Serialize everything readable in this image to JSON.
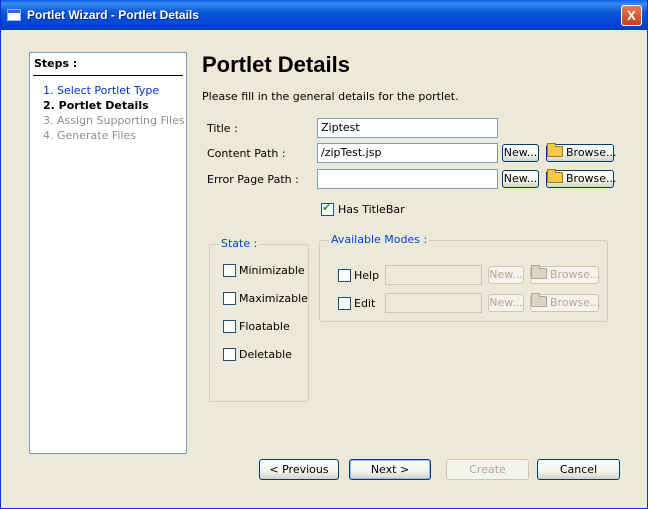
{
  "window": {
    "title": "Portlet Wizard - Portlet Details",
    "close_glyph": "X"
  },
  "steps": {
    "heading": "Steps :",
    "items": [
      {
        "label": "1. Select Portlet Type",
        "state": "done"
      },
      {
        "label": "2. Portlet Details",
        "state": "current"
      },
      {
        "label": "3. Assign Supporting Files",
        "state": "future"
      },
      {
        "label": "4. Generate Files",
        "state": "future"
      }
    ]
  },
  "page": {
    "title": "Portlet Details",
    "description": "Please fill in the general details for the portlet."
  },
  "form": {
    "title_label": "Title :",
    "title_value": "Ziptest",
    "content_path_label": "Content Path :",
    "content_path_value": "/zipTest.jsp",
    "error_page_label": "Error Page Path :",
    "error_page_value": "",
    "new_label": "New...",
    "browse_label": "Browse...",
    "has_titlebar_label": "Has TitleBar",
    "has_titlebar_checked": true
  },
  "state_group": {
    "title": "State :",
    "options": [
      {
        "label": "Minimizable",
        "checked": false
      },
      {
        "label": "Maximizable",
        "checked": false
      },
      {
        "label": "Floatable",
        "checked": false
      },
      {
        "label": "Deletable",
        "checked": false
      }
    ]
  },
  "modes_group": {
    "title": "Available Modes :",
    "modes": [
      {
        "label": "Help",
        "checked": false,
        "value": ""
      },
      {
        "label": "Edit",
        "checked": false,
        "value": ""
      }
    ],
    "new_label": "New...",
    "browse_label": "Browse..."
  },
  "footer": {
    "previous": "< Previous",
    "next": "Next >",
    "create": "Create",
    "cancel": "Cancel"
  },
  "colors": {
    "titlebar": "#0048d4",
    "dialog_bg": "#ece9d8",
    "link_blue": "#0033cc",
    "group_title": "#0046d5"
  }
}
